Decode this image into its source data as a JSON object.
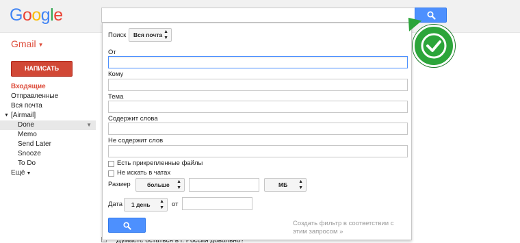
{
  "header": {
    "logo_letters": [
      "G",
      "o",
      "o",
      "g",
      "l",
      "e"
    ],
    "logo_colors": [
      "#4285f4",
      "#ea4335",
      "#fbbc05",
      "#4285f4",
      "#34a853",
      "#ea4335"
    ],
    "search_value": "",
    "search_icon": "search-icon"
  },
  "sidebar": {
    "app_label": "Gmail",
    "compose_label": "НАПИСАТЬ",
    "items": [
      {
        "label": "Входящие"
      },
      {
        "label": "Отправленные"
      },
      {
        "label": "Вся почта"
      },
      {
        "label": "[Airmail]"
      },
      {
        "label": "Done"
      },
      {
        "label": "Memo"
      },
      {
        "label": "Send Later"
      },
      {
        "label": "Snooze"
      },
      {
        "label": "To Do"
      },
      {
        "label": "Ещё"
      }
    ]
  },
  "search_panel": {
    "search_in_label": "Поиск",
    "search_in_value": "Вся почта",
    "from_label": "От",
    "to_label": "Кому",
    "subject_label": "Тема",
    "has_words_label": "Содержит слова",
    "no_words_label": "Не содержит слов",
    "has_attachment_label": "Есть прикрепленные файлы",
    "no_chats_label": "Не искать в чатах",
    "size_label": "Размер",
    "size_op_value": "больше",
    "size_unit_value": "МБ",
    "date_label": "Дата",
    "date_range_value": "1 день",
    "date_from_label": "от",
    "filter_link": "Создать фильтр в соответствии с этим запросом »"
  },
  "list_peek": {
    "text": "Думаете остаться в г. Россия довольно?"
  },
  "colors": {
    "accent_blue": "#4d90fe",
    "brand_red": "#dd4b39",
    "compose_red": "#d14836",
    "check_green": "#2ca53a"
  }
}
